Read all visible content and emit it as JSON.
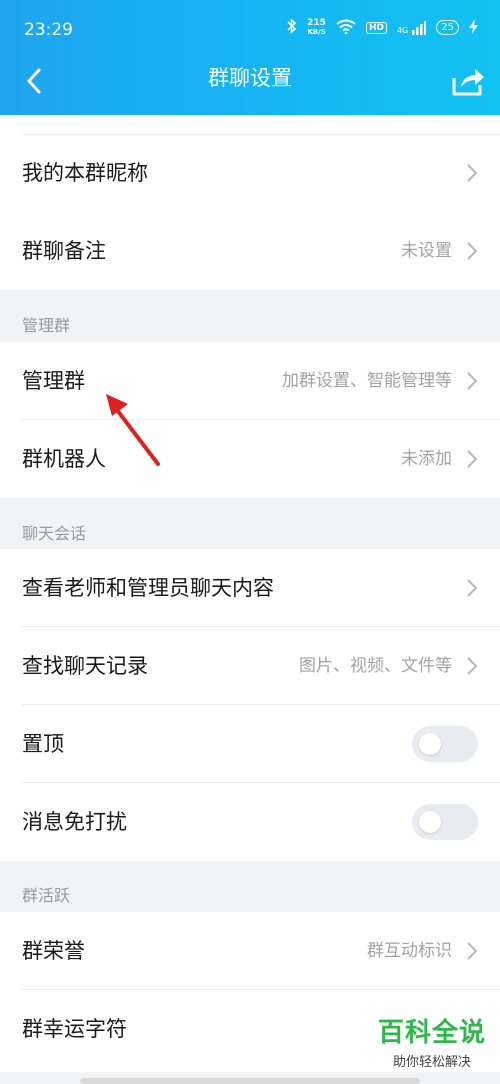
{
  "status_bar": {
    "time": "23:29",
    "speed_value": "215",
    "speed_unit": "KB/S",
    "hd_label": "HD",
    "network_label": "4G",
    "battery": "25"
  },
  "nav": {
    "title": "群聊设置"
  },
  "rows_top": [
    {
      "label": "我的本群昵称",
      "value": ""
    },
    {
      "label": "群聊备注",
      "value": "未设置"
    }
  ],
  "group_manage": {
    "header": "管理群",
    "rows": [
      {
        "label": "管理群",
        "value": "加群设置、智能管理等"
      },
      {
        "label": "群机器人",
        "value": "未添加"
      }
    ]
  },
  "group_chat": {
    "header": "聊天会话",
    "rows": [
      {
        "label": "查看老师和管理员聊天内容",
        "value": ""
      },
      {
        "label": "查找聊天记录",
        "value": "图片、视频、文件等"
      },
      {
        "label": "置顶",
        "toggle": false
      },
      {
        "label": "消息免打扰",
        "toggle": false
      }
    ]
  },
  "group_active": {
    "header": "群活跃",
    "rows": [
      {
        "label": "群荣誉",
        "value": "群互动标识"
      },
      {
        "label": "群幸运字符",
        "value": ""
      }
    ]
  },
  "watermark": {
    "main": "百科全说",
    "sub": "助你轻松解决"
  },
  "colors": {
    "accent": "#1fa4ef",
    "annotation_arrow": "#e02020",
    "watermark": "#2eb84a"
  }
}
